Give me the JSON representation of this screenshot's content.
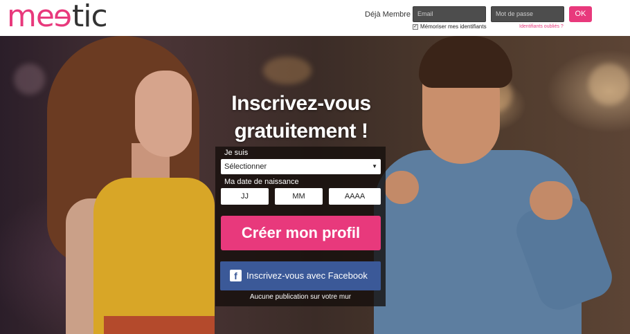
{
  "header": {
    "logo": "meetic",
    "deja_membre": "Déjà Membre",
    "email_placeholder": "Email",
    "password_placeholder": "Mot de passe",
    "ok_label": "OK",
    "remember_label": "Mémoriser mes identifiants",
    "forgot_label": "Identifiants oubliés ?"
  },
  "signup": {
    "headline_line1": "Inscrivez-vous",
    "headline_line2": "gratuitement !",
    "je_suis_label": "Je suis",
    "select_value": "Sélectionner",
    "birthdate_label": "Ma date de naissance",
    "day_placeholder": "JJ",
    "month_placeholder": "MM",
    "year_placeholder": "AAAA",
    "create_button": "Créer mon profil",
    "facebook_button": "Inscrivez-vous avec Facebook",
    "no_publication": "Aucune publication sur votre mur"
  },
  "colors": {
    "brand_pink": "#e8397c",
    "facebook_blue": "#3b5998"
  },
  "icons": {
    "facebook": "facebook-icon",
    "dropdown": "chevron-down-icon",
    "checkbox": "checkbox-checked-icon"
  }
}
